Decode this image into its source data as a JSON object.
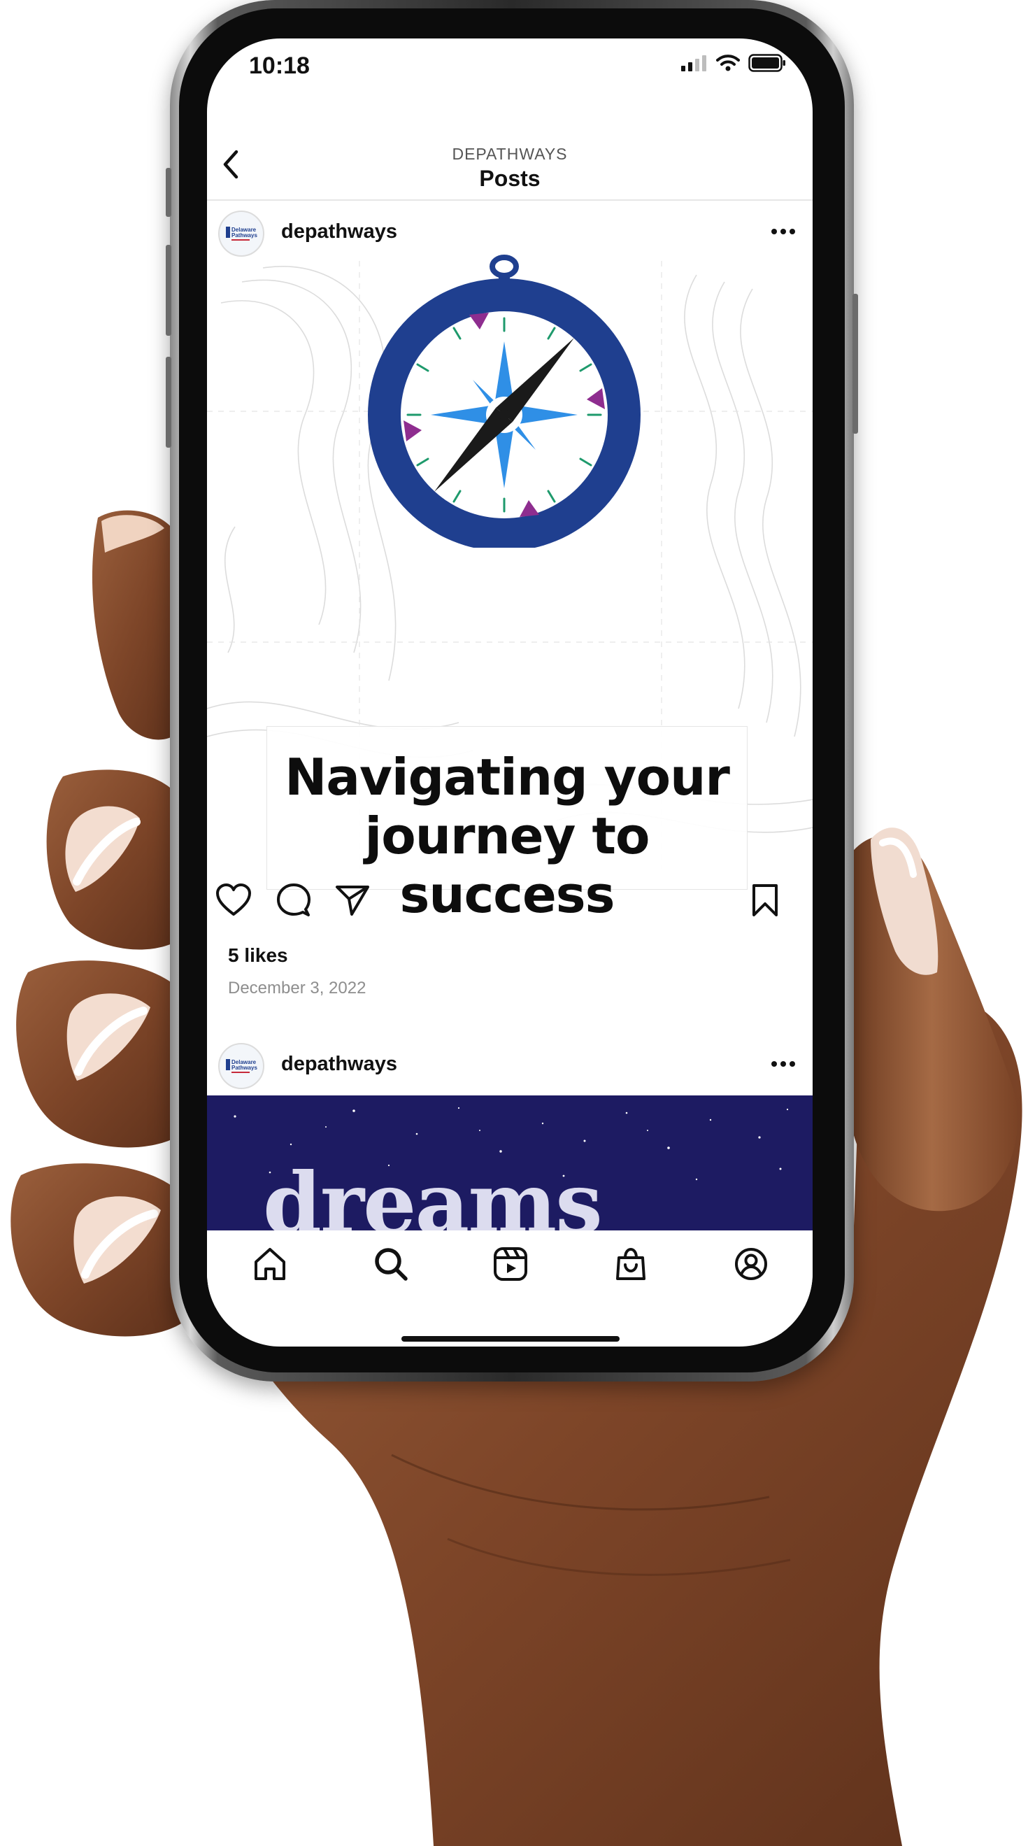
{
  "status_bar": {
    "time": "10:18"
  },
  "header": {
    "account_label": "DEPATHWAYS",
    "title": "Posts"
  },
  "posts": [
    {
      "username": "depathways",
      "avatar_text": [
        "Delaware",
        "Pathways"
      ],
      "image": {
        "headline_line1": "Navigating your",
        "headline_line2": "journey to success"
      },
      "likes": "5 likes",
      "date": "December 3, 2022"
    },
    {
      "username": "depathways",
      "avatar_text": [
        "Delaware",
        "Pathways"
      ],
      "image": {
        "word": "dreams"
      }
    }
  ],
  "icons": {
    "back": "chevron-left-icon",
    "more": "ellipsis-icon",
    "like": "heart-icon",
    "comment": "comment-icon",
    "share": "send-icon",
    "save": "bookmark-icon",
    "home": "home-icon",
    "search": "search-icon",
    "reels": "reels-icon",
    "shop": "shop-icon",
    "profile": "profile-icon"
  },
  "colors": {
    "compass_ring": "#1f3f8f",
    "compass_star": "#2f8fe6",
    "compass_magenta": "#8e2d8f",
    "compass_ticks": "#1e9a6c",
    "dreams_bg": "#1d1b62"
  }
}
